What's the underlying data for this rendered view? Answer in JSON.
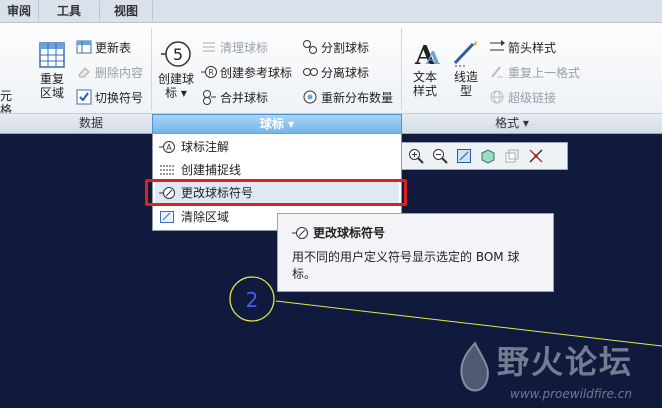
{
  "tabs": [
    "审阅",
    "工具",
    "视图"
  ],
  "ribbon": {
    "cut_left": "元格",
    "table_group": {
      "big_button": "重复\n区域",
      "items": [
        {
          "label": "更新表",
          "enabled": true
        },
        {
          "label": "删除内容",
          "enabled": false
        },
        {
          "label": "切换符号",
          "enabled": true
        }
      ]
    },
    "balloon_group": {
      "big_icon_text": "5",
      "big_button": "创建球\n标 ▾",
      "col1": [
        {
          "label": "清理球标",
          "enabled": false
        },
        {
          "label": "创建参考球标",
          "enabled": true
        },
        {
          "label": "合并球标",
          "enabled": true
        }
      ],
      "col2": [
        {
          "label": "分割球标",
          "enabled": true
        },
        {
          "label": "分离球标",
          "enabled": true
        },
        {
          "label": "重新分布数量",
          "enabled": true
        }
      ]
    },
    "format_group": {
      "big1": "文本\n样式",
      "big2": "线造\n型",
      "items": [
        {
          "label": "箭头样式",
          "enabled": true
        },
        {
          "label": "重复上一格式",
          "enabled": false
        },
        {
          "label": "超级链接",
          "enabled": false
        }
      ]
    },
    "group_labels": {
      "data": "数据",
      "balloon": "球标 ▾",
      "format": "格式 ▾"
    }
  },
  "menu": {
    "items": [
      {
        "label": "球标注解",
        "icon": "balloon-note-icon"
      },
      {
        "label": "创建捕捉线",
        "icon": "snap-lines-icon"
      },
      {
        "label": "更改球标符号",
        "icon": "change-balloon-symbol-icon",
        "highlighted": true
      },
      {
        "label": "清除区域",
        "icon": "clear-area-icon"
      }
    ]
  },
  "tooltip": {
    "title": "更改球标符号",
    "description": "用不同的用户定义符号显示选定的 BOM 球标。"
  },
  "canvas": {
    "balloon_number": "2"
  },
  "watermark": {
    "text": "野火论坛",
    "url": "www.proewildfire.cn"
  },
  "colors": {
    "canvas_bg": "#101a3c",
    "highlight_box": "#e02020",
    "balloon_yellow": "#e8e84a",
    "balloon_number": "#4b5cf0",
    "group_active": "#6fb4ea"
  }
}
